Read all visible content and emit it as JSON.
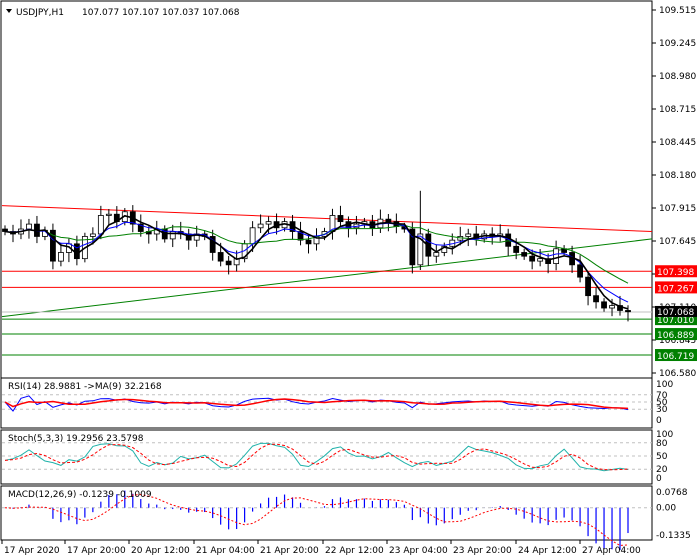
{
  "header": {
    "symbol": "USDJPY,H1",
    "ohlc": "107.077 107.107 107.037 107.068"
  },
  "colors": {
    "up_candle": "#ffffff",
    "down_candle": "#000000",
    "ma_red": "#ff0000",
    "ma_green": "#008000",
    "ma_blue": "#0000ff",
    "ma_black": "#000000",
    "resistance": "#ff0000",
    "support": "#008000",
    "rsi": "#0000ff",
    "rsi_ma": "#ff0000",
    "stoch_main": "#20b2aa",
    "stoch_signal": "#ff0000",
    "macd_hist": "#0000ff",
    "macd_signal": "#ff0000"
  },
  "chart_data": [
    {
      "type": "candlestick",
      "title": "USDJPY,H1",
      "y_ticks": [
        "109.515",
        "109.245",
        "108.980",
        "108.715",
        "108.445",
        "108.180",
        "107.915",
        "107.645",
        "107.380",
        "107.110",
        "106.845",
        "106.580"
      ],
      "ylim": [
        106.55,
        109.6
      ],
      "closes": [
        107.72,
        107.7,
        107.74,
        107.78,
        107.68,
        107.73,
        107.48,
        107.55,
        107.62,
        107.5,
        107.68,
        107.7,
        107.85,
        107.86,
        107.8,
        107.88,
        107.78,
        107.72,
        107.7,
        107.74,
        107.66,
        107.72,
        107.7,
        107.65,
        107.7,
        107.68,
        107.55,
        107.48,
        107.45,
        107.5,
        107.62,
        107.75,
        107.78,
        107.8,
        107.75,
        107.8,
        107.72,
        107.65,
        107.62,
        107.68,
        107.72,
        107.85,
        107.8,
        107.75,
        107.78,
        107.8,
        107.75,
        107.82,
        107.8,
        107.76,
        107.74,
        107.45,
        107.7,
        107.52,
        107.55,
        107.6,
        107.65,
        107.68,
        107.7,
        107.66,
        107.7,
        107.68,
        107.7,
        107.6,
        107.55,
        107.52,
        107.48,
        107.5,
        107.46,
        107.58,
        107.55,
        107.45,
        107.35,
        107.2,
        107.15,
        107.1,
        107.12,
        107.08,
        107.07
      ],
      "levels": [
        {
          "label": "107.398",
          "value": 107.398,
          "kind": "resistance"
        },
        {
          "label": "107.267",
          "value": 107.267,
          "kind": "resistance"
        },
        {
          "label": "107.010",
          "value": 107.01,
          "kind": "support"
        },
        {
          "label": "106.889",
          "value": 106.889,
          "kind": "support"
        },
        {
          "label": "106.719",
          "value": 106.719,
          "kind": "support"
        }
      ],
      "current_price": {
        "label": "107.068",
        "value": 107.068
      },
      "trendline": {
        "start": 107.03,
        "end": 107.66
      },
      "long_ma": {
        "start": 107.93,
        "end": 107.72
      }
    },
    {
      "type": "line",
      "title": "RSI(14) 28.9881  ->MA(9) 32.2168",
      "y_ticks": [
        "100",
        "70",
        "50",
        "30",
        "0"
      ],
      "ylim": [
        0,
        100
      ],
      "levels": [
        70,
        50,
        30
      ]
    },
    {
      "type": "line",
      "title": "Stoch(5,3,3) 19.2956 23.5798",
      "y_ticks": [
        "100",
        "80",
        "50",
        "20",
        "0"
      ],
      "ylim": [
        0,
        100
      ],
      "levels": [
        80,
        50,
        20
      ]
    },
    {
      "type": "bar",
      "title": "MACD(12,26,9) -0.1239 -0.1009",
      "y_ticks": [
        "0.0768",
        "0.00",
        "-0.1335"
      ],
      "ylim": [
        -0.1335,
        0.0768
      ]
    }
  ],
  "time_axis": [
    "17 Apr 2020",
    "17 Apr 20:00",
    "20 Apr 12:00",
    "21 Apr 04:00",
    "21 Apr 20:00",
    "22 Apr 12:00",
    "23 Apr 04:00",
    "23 Apr 20:00",
    "24 Apr 12:00",
    "27 Apr 04:00"
  ]
}
